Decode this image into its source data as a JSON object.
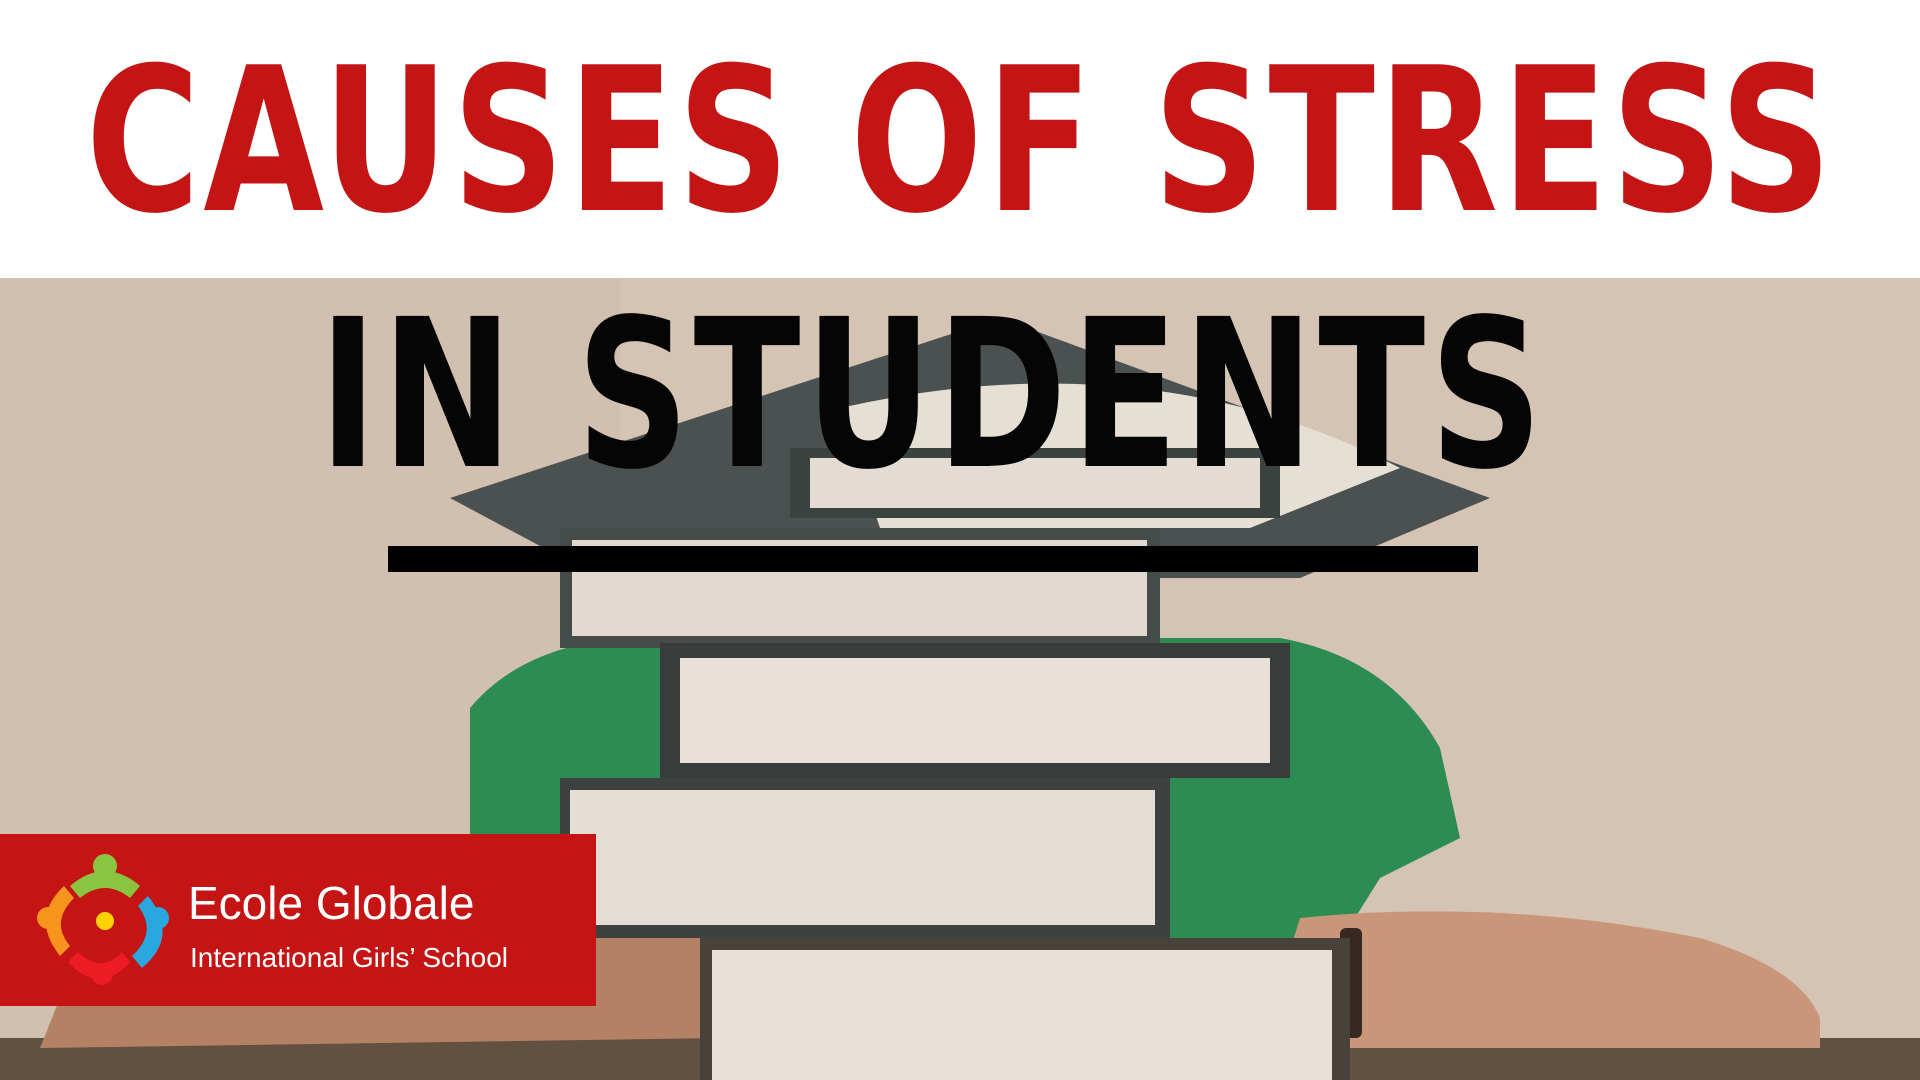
{
  "header": {
    "title": "CAUSES OF STRESS",
    "title_color": "#c41414"
  },
  "subtitle": {
    "text": "IN STUDENTS",
    "underlined": true
  },
  "logo": {
    "name": "Ecole Globale",
    "tagline": "International Girls’ School",
    "background_color": "#c41414",
    "icon": "children-circle-logo-icon"
  },
  "photo": {
    "subject": "student-behind-book-stack"
  }
}
